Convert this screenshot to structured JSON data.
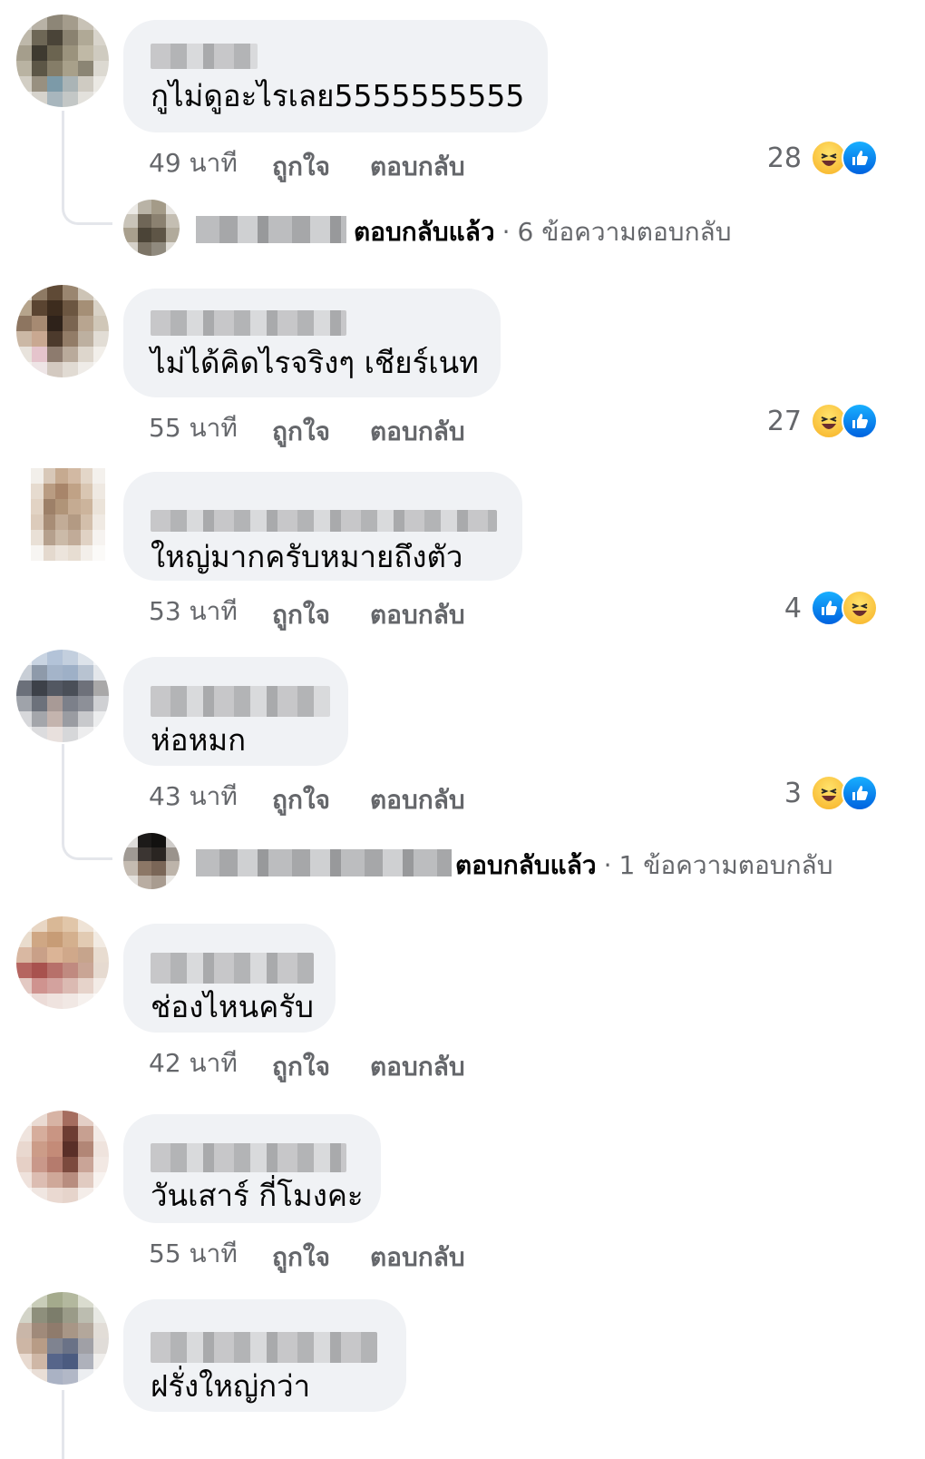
{
  "colors": {
    "bubble_bg": "#f0f2f5",
    "meta_text": "#65676b",
    "like_blue": "#1877f2",
    "haha_yellow": "#f7b125"
  },
  "comments": [
    {
      "text": "กูไม่ดูอะไรเลย5555555555",
      "time": "49 นาที",
      "like_label": "ถูกใจ",
      "reply_label": "ตอบกลับ",
      "reaction_count": "28",
      "reaction_icons": [
        "haha-icon",
        "like-icon"
      ],
      "replies": {
        "replied_label": "ตอบกลับแล้ว",
        "separator": "·",
        "count_label": "6 ข้อความตอบกลับ"
      }
    },
    {
      "text": "ไม่ได้คิดไรจริงๆ เชียร์เนท",
      "time": "55 นาที",
      "like_label": "ถูกใจ",
      "reply_label": "ตอบกลับ",
      "reaction_count": "27",
      "reaction_icons": [
        "haha-icon",
        "like-icon"
      ]
    },
    {
      "text": "ใหญ่มากครับหมายถึงตัว",
      "time": "53 นาที",
      "like_label": "ถูกใจ",
      "reply_label": "ตอบกลับ",
      "reaction_count": "4",
      "reaction_icons": [
        "like-icon",
        "haha-icon"
      ]
    },
    {
      "text": "ห่อหมก",
      "time": "43 นาที",
      "like_label": "ถูกใจ",
      "reply_label": "ตอบกลับ",
      "reaction_count": "3",
      "reaction_icons": [
        "haha-icon",
        "like-icon"
      ],
      "replies": {
        "replied_label": "ตอบกลับแล้ว",
        "separator": "·",
        "count_label": "1 ข้อความตอบกลับ"
      }
    },
    {
      "text": "ช่องไหนครับ",
      "time": "42 นาที",
      "like_label": "ถูกใจ",
      "reply_label": "ตอบกลับ"
    },
    {
      "text": "วันเสาร์ กี่โมงคะ",
      "time": "55 นาที",
      "like_label": "ถูกใจ",
      "reply_label": "ตอบกลับ"
    },
    {
      "text": "ฝรั่งใหญ่กว่า"
    }
  ]
}
